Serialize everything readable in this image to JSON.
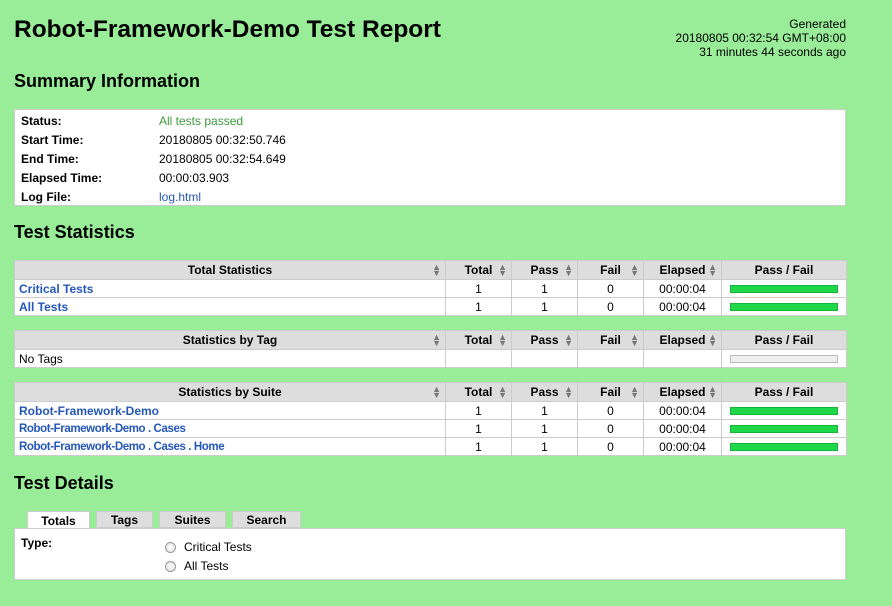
{
  "title": "Robot-Framework-Demo Test Report",
  "generated": {
    "label": "Generated",
    "timestamp": "20180805 00:32:54 GMT+08:00",
    "ago": "31 minutes 44 seconds ago"
  },
  "sections": {
    "summary": "Summary Information",
    "statistics": "Test Statistics",
    "details": "Test Details"
  },
  "summary": {
    "rows": [
      {
        "key": "Status:",
        "value": "All tests passed"
      },
      {
        "key": "Start Time:",
        "value": "20180805 00:32:50.746"
      },
      {
        "key": "End Time:",
        "value": "20180805 00:32:54.649"
      },
      {
        "key": "Elapsed Time:",
        "value": "00:00:03.903"
      },
      {
        "key": "Log File:",
        "value": "log.html"
      }
    ]
  },
  "columns": [
    "Total",
    "Pass",
    "Fail",
    "Elapsed",
    "Pass / Fail"
  ],
  "total_stats": {
    "header": "Total Statistics",
    "rows": [
      {
        "name": "Critical Tests",
        "total": "1",
        "pass": "1",
        "fail": "0",
        "elapsed": "00:00:04",
        "pass_ratio": 1
      },
      {
        "name": "All Tests",
        "total": "1",
        "pass": "1",
        "fail": "0",
        "elapsed": "00:00:04",
        "pass_ratio": 1
      }
    ]
  },
  "tag_stats": {
    "header": "Statistics by Tag",
    "rows": [
      {
        "name": "No Tags"
      }
    ]
  },
  "suite_stats": {
    "header": "Statistics by Suite",
    "rows": [
      {
        "name": "Robot-Framework-Demo",
        "total": "1",
        "pass": "1",
        "fail": "0",
        "elapsed": "00:00:04",
        "pass_ratio": 1
      },
      {
        "name": "Robot-Framework-Demo . Cases",
        "total": "1",
        "pass": "1",
        "fail": "0",
        "elapsed": "00:00:04",
        "pass_ratio": 1
      },
      {
        "name": "Robot-Framework-Demo . Cases . Home",
        "total": "1",
        "pass": "1",
        "fail": "0",
        "elapsed": "00:00:04",
        "pass_ratio": 1
      }
    ]
  },
  "tabs": [
    "Totals",
    "Tags",
    "Suites",
    "Search"
  ],
  "active_tab": "Totals",
  "details": {
    "type_label": "Type:",
    "options": [
      "Critical Tests",
      "All Tests"
    ]
  },
  "colors": {
    "background": "#99ed99",
    "pass": "#1ed84a",
    "link": "#2457b8",
    "status_pass": "#3d9b3d"
  }
}
